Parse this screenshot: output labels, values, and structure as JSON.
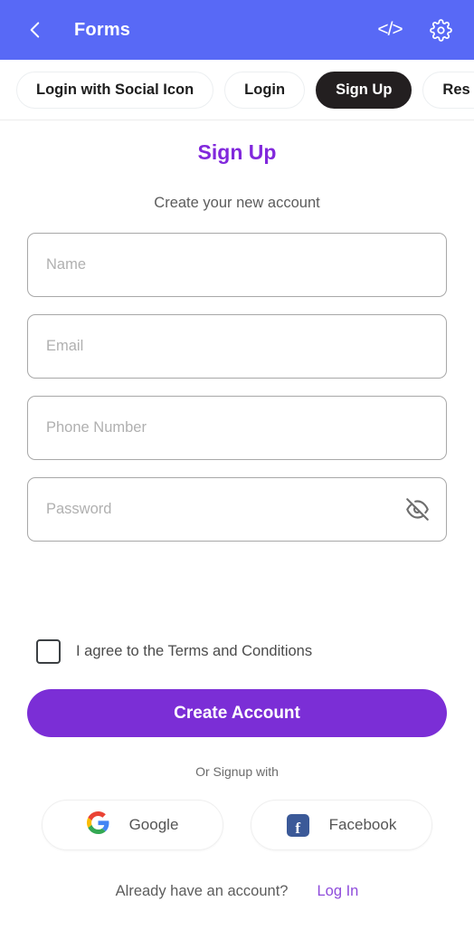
{
  "appbar": {
    "title": "Forms",
    "back_icon": "chevron-left-icon",
    "code_icon_label": "</>",
    "settings_icon": "gear-icon",
    "background_color": "#5869F6"
  },
  "tabs": [
    {
      "label": "Login with Social Icon",
      "active": false
    },
    {
      "label": "Login",
      "active": false
    },
    {
      "label": "Sign Up",
      "active": true
    },
    {
      "label": "Res",
      "active": false
    }
  ],
  "page": {
    "title": "Sign Up",
    "subtitle": "Create your new account",
    "title_color": "#8128DC"
  },
  "fields": [
    {
      "name": "name",
      "placeholder": "Name",
      "value": ""
    },
    {
      "name": "email",
      "placeholder": "Email",
      "value": ""
    },
    {
      "name": "phone",
      "placeholder": "Phone Number",
      "value": ""
    },
    {
      "name": "password",
      "placeholder": "Password",
      "value": "",
      "toggle_icon": "eye-off-icon"
    }
  ],
  "terms": {
    "label": "I agree to the Terms and Conditions",
    "checked": false
  },
  "primary_button": {
    "label": "Create Account",
    "color": "#7B2ED6"
  },
  "social": {
    "divider_text": "Or Signup with",
    "buttons": [
      {
        "label": "Google",
        "icon": "google-icon"
      },
      {
        "label": "Facebook",
        "icon": "facebook-icon"
      }
    ]
  },
  "footer": {
    "text": "Already have an account?",
    "link": "Log In",
    "link_color": "#8E4BDB"
  }
}
